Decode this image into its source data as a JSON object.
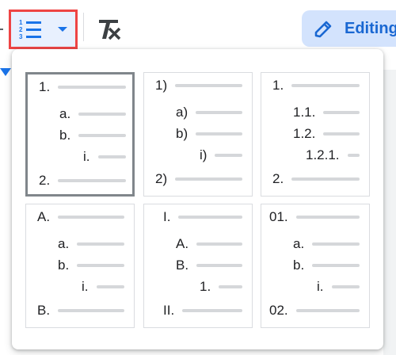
{
  "toolbar": {
    "numbered_list_icon": "numbered-list-icon",
    "dropdown_caret_icon": "chevron-down-icon",
    "clear_formatting_icon": "clear-formatting-icon",
    "editing_icon": "pencil-icon",
    "editing_label": "Editing",
    "accent": "#1a73e8",
    "highlight_border": "#ee4444"
  },
  "list_styles": {
    "selected_index": 0,
    "options": [
      {
        "name": "decimal-alpha-roman",
        "items": [
          "1.",
          "a.",
          "b.",
          "i.",
          "2."
        ]
      },
      {
        "name": "parenthesis",
        "items": [
          "1)",
          "a)",
          "b)",
          "i)",
          "2)"
        ]
      },
      {
        "name": "outline-decimal",
        "items": [
          "1.",
          "1.1.",
          "1.2.",
          "1.2.1.",
          "2."
        ]
      },
      {
        "name": "alpha-upper",
        "items": [
          "A.",
          "a.",
          "b.",
          "i.",
          "B."
        ]
      },
      {
        "name": "roman-upper",
        "items": [
          "I.",
          "A.",
          "B.",
          "1.",
          "II."
        ]
      },
      {
        "name": "zero-padded-decimal",
        "items": [
          "01.",
          "a.",
          "b.",
          "i.",
          "02."
        ]
      }
    ]
  }
}
